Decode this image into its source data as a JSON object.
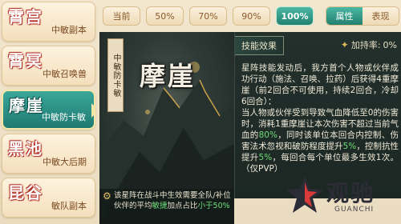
{
  "menu": {
    "items": [
      {
        "name": "霄宫",
        "sub": "中敏副本"
      },
      {
        "name": "霄冥",
        "sub": "中敏召唤兽"
      },
      {
        "name": "摩崖",
        "sub": "中敏防卡敏"
      },
      {
        "name": "黑池",
        "sub": "中敏大后期"
      },
      {
        "name": "昆谷",
        "sub": "敏队副本"
      }
    ],
    "active_index": 2
  },
  "tabs": {
    "items": [
      "当前",
      "50%",
      "70%",
      "90%",
      "100%"
    ],
    "active": "100%"
  },
  "segment": {
    "attr_label": "属性",
    "perf_label": "表现"
  },
  "art": {
    "vertical_tag": "中敏防卡敏",
    "title": "摩崖"
  },
  "skill": {
    "header": "技能效果",
    "bonus_label": "加持率:",
    "bonus_value": "0%",
    "desc_plain_1": "星阵技能发动后，我方首个人物或伙伴成功行动（施法、召唤、拉药）后获得4重摩崖（前2回合不可使用，持续2回合，冷却6回合）：",
    "desc_plain_2": "当人物或伙伴受到导致气血降低至0的伤害时，消耗1重摩崖让本次伤害不超过当前气血的",
    "desc_hl_1": "80%",
    "desc_plain_3": "，同时该单位本回合内控制、伤害法术忽视和破防程度提升",
    "desc_hl_2": "5%",
    "desc_plain_4": "，控制抗性提升",
    "desc_hl_3": "5%",
    "desc_plain_5": "，每回合每个单位最多生效1次。（仅PVP）"
  },
  "note": {
    "part1": "该星阵在战斗中生效需要全队/补位伙伴的平均",
    "hl1": "敏捷",
    "part2": "加点占比",
    "hl2": "小于50%"
  },
  "watermark": {
    "cn": "观驰",
    "en": "GUANCHI"
  }
}
